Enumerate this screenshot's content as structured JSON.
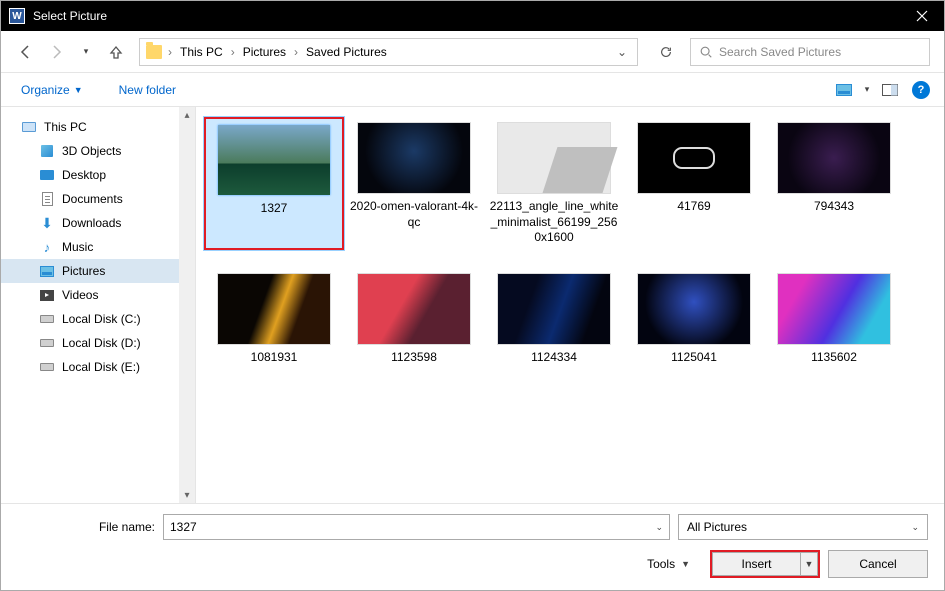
{
  "title": "Select Picture",
  "breadcrumbs": [
    "This PC",
    "Pictures",
    "Saved Pictures"
  ],
  "search": {
    "placeholder": "Search Saved Pictures"
  },
  "toolbar": {
    "organize": "Organize",
    "newfolder": "New folder"
  },
  "sidebar": {
    "items": [
      {
        "label": "This PC",
        "icon": "pc",
        "child": false
      },
      {
        "label": "3D Objects",
        "icon": "3d",
        "child": true
      },
      {
        "label": "Desktop",
        "icon": "desktop",
        "child": true
      },
      {
        "label": "Documents",
        "icon": "doc",
        "child": true
      },
      {
        "label": "Downloads",
        "icon": "down",
        "child": true
      },
      {
        "label": "Music",
        "icon": "music",
        "child": true
      },
      {
        "label": "Pictures",
        "icon": "pict",
        "child": true,
        "selected": true
      },
      {
        "label": "Videos",
        "icon": "video",
        "child": true
      },
      {
        "label": "Local Disk (C:)",
        "icon": "disk",
        "child": true
      },
      {
        "label": "Local Disk (D:)",
        "icon": "disk",
        "child": true
      },
      {
        "label": "Local Disk (E:)",
        "icon": "disk",
        "child": true
      }
    ]
  },
  "files": [
    {
      "name": "1327",
      "theme": "th-1327",
      "selected": true
    },
    {
      "name": "2020-omen-valorant-4k-qc",
      "theme": "th-omen"
    },
    {
      "name": "22113_angle_line_white_minimalist_66199_2560x1600",
      "theme": "th-angle"
    },
    {
      "name": "41769",
      "theme": "th-41769"
    },
    {
      "name": "794343",
      "theme": "th-794343"
    },
    {
      "name": "1081931",
      "theme": "th-1081931"
    },
    {
      "name": "1123598",
      "theme": "th-1123598"
    },
    {
      "name": "1124334",
      "theme": "th-1124334"
    },
    {
      "name": "1125041",
      "theme": "th-1125041"
    },
    {
      "name": "1135602",
      "theme": "th-1135602"
    }
  ],
  "bottom": {
    "filename_label": "File name:",
    "filename_value": "1327",
    "filter": "All Pictures",
    "tools": "Tools",
    "insert": "Insert",
    "cancel": "Cancel"
  }
}
